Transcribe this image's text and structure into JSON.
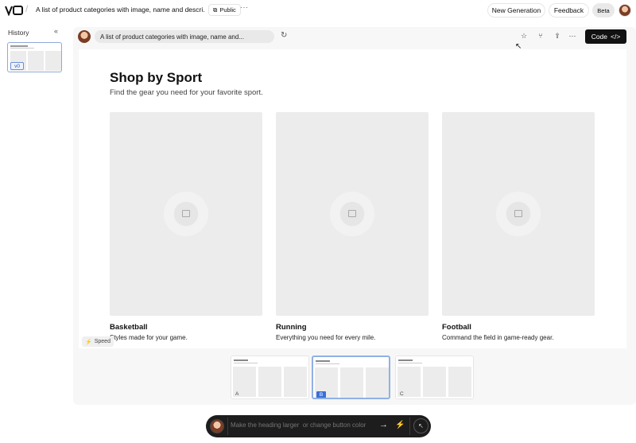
{
  "header": {
    "title": "A list of product categories with image, name and descri...",
    "public_label": "Public",
    "more_label": "···",
    "new_generation_label": "New Generation",
    "feedback_label": "Feedback",
    "beta_label": "Beta"
  },
  "sidebar": {
    "history_label": "History",
    "collapse_glyph": "«",
    "versions": [
      {
        "label": "v0"
      }
    ]
  },
  "toolbar": {
    "prompt_text": "A list of product categories with image, name and...",
    "code_label": "Code"
  },
  "preview": {
    "heading": "Shop by Sport",
    "subheading": "Find the gear you need for your favorite sport.",
    "categories": [
      {
        "name": "Basketball",
        "description": "Styles made for your game."
      },
      {
        "name": "Running",
        "description": "Everything you need for every mile."
      },
      {
        "name": "Football",
        "description": "Command the field in game-ready gear."
      }
    ],
    "speed_label": "Speed"
  },
  "variants": [
    {
      "label": "A",
      "selected": false
    },
    {
      "label": "B",
      "selected": true
    },
    {
      "label": "C",
      "selected": false
    }
  ],
  "chat": {
    "placeholder": "Make the heading larger  or change button color"
  },
  "colors": {
    "accent": "#3b6fd6",
    "code_button": "#111111",
    "chatbar": "#1d1d1d"
  }
}
